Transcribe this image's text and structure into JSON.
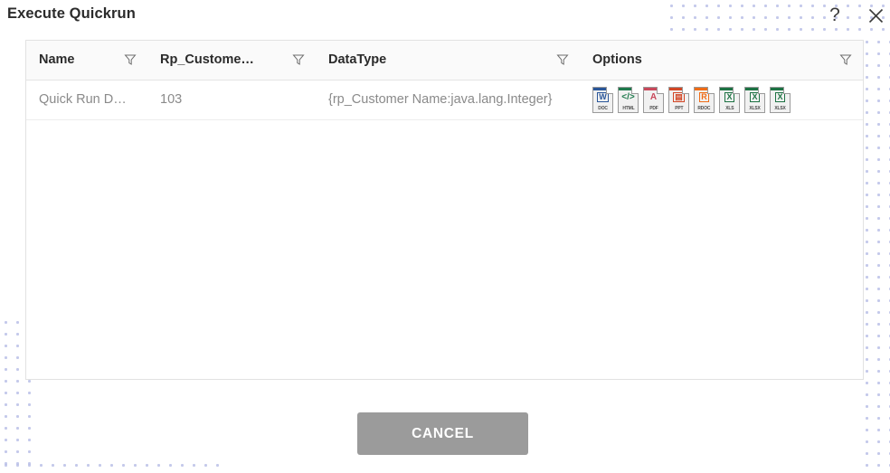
{
  "dialog": {
    "title": "Execute Quickrun",
    "help_label": "?",
    "close_label": "×"
  },
  "grid": {
    "columns": [
      {
        "label": "Name",
        "filter_icon": "filter-icon"
      },
      {
        "label": "Rp_Custome…",
        "filter_icon": "filter-icon"
      },
      {
        "label": "DataType",
        "filter_icon": "filter-icon"
      },
      {
        "label": "Options",
        "filter_icon": "filter-icon"
      }
    ],
    "rows": [
      {
        "name": "Quick Run D…",
        "param": "103",
        "datatype": "{rp_Customer Name:java.lang.Integer}"
      }
    ],
    "option_icons": [
      {
        "label": "DOC",
        "glyph": "W",
        "icon_name": "export-doc-icon",
        "color": "#2a5699",
        "boxed": true
      },
      {
        "label": "HTML",
        "glyph": "</>",
        "icon_name": "export-html-icon",
        "color": "#1f7a4d",
        "boxed": false
      },
      {
        "label": "PDF",
        "glyph": "A",
        "icon_name": "export-pdf-icon",
        "color": "#c9485b",
        "boxed": false
      },
      {
        "label": "PPT",
        "glyph": "▤",
        "icon_name": "export-ppt-icon",
        "color": "#d24726",
        "boxed": true
      },
      {
        "label": "RDOC",
        "glyph": "R",
        "icon_name": "export-rdoc-icon",
        "color": "#ef6c16",
        "boxed": true
      },
      {
        "label": "XLS",
        "glyph": "X",
        "icon_name": "export-xls-icon",
        "color": "#1d7243",
        "boxed": true
      },
      {
        "label": "XLSX",
        "glyph": "X",
        "icon_name": "export-xlsx-icon",
        "color": "#1d7243",
        "boxed": true
      },
      {
        "label": "XLSX",
        "glyph": "X",
        "icon_name": "export-xlsx-alt-icon",
        "color": "#1d7243",
        "boxed": true
      }
    ]
  },
  "footer": {
    "cancel_label": "CANCEL"
  },
  "colors": {
    "header_bg": "#fafafa",
    "cancel_bg": "#9b9b9b",
    "dot_color": "#b9bfe8",
    "title_text": "#2b2b2b",
    "cell_text": "#8a8a8a"
  }
}
